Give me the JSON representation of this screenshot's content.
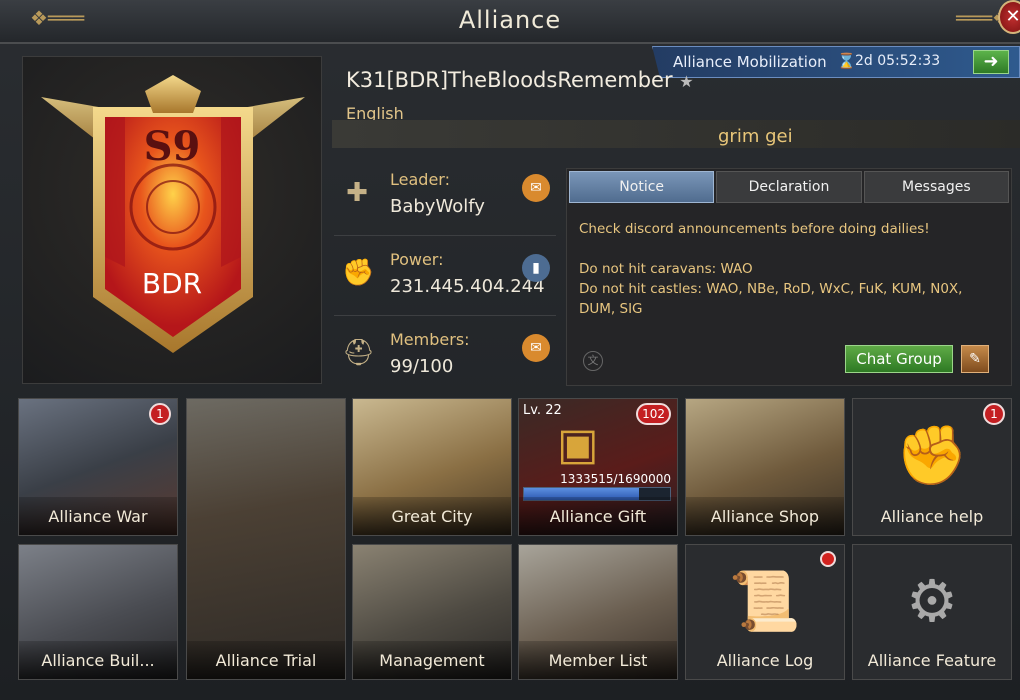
{
  "window": {
    "title": "Alliance"
  },
  "mobilization": {
    "label": "Alliance Mobilization",
    "timer": "2d 05:52:33"
  },
  "alliance": {
    "name": "K31[BDR]TheBloodsRemember",
    "language": "English",
    "nickname": "grim gei",
    "tag": "BDR",
    "season": "S9"
  },
  "stats": {
    "leader": {
      "label": "Leader:",
      "value": "BabyWolfy"
    },
    "power": {
      "label": "Power:",
      "value": "231.445.404.244"
    },
    "members": {
      "label": "Members:",
      "value": "99/100"
    }
  },
  "notice": {
    "tabs": [
      "Notice",
      "Declaration",
      "Messages"
    ],
    "lines": [
      "Check discord announcements before doing dailies!",
      "",
      "Do not hit caravans: WAO",
      "Do not hit castles: WAO, NBe, RoD, WxC, FuK, KUM, N0X, DUM, SIG"
    ],
    "chat_button": "Chat Group"
  },
  "cards": {
    "alliance_war": {
      "label": "Alliance War",
      "badge": "1"
    },
    "alliance_trial": {
      "label": "Alliance Trial"
    },
    "great_city": {
      "label": "Great City"
    },
    "alliance_gift": {
      "label": "Alliance Gift",
      "badge": "102",
      "level": "Lv. 22",
      "progress_text": "1333515/1690000",
      "progress": 0.789
    },
    "alliance_shop": {
      "label": "Alliance Shop"
    },
    "alliance_help": {
      "label": "Alliance help",
      "badge": "1"
    },
    "alliance_buildings": {
      "label": "Alliance Buil..."
    },
    "management": {
      "label": "Management"
    },
    "member_list": {
      "label": "Member List"
    },
    "alliance_log": {
      "label": "Alliance Log"
    },
    "alliance_feature": {
      "label": "Alliance Feature"
    }
  }
}
